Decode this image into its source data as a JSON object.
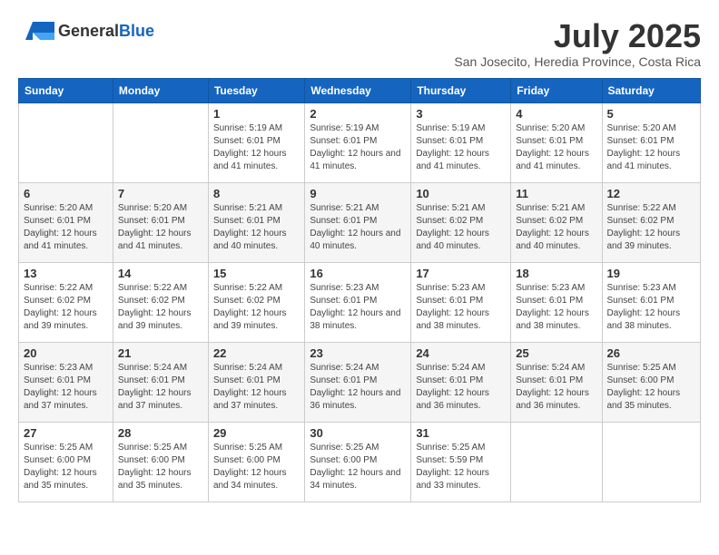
{
  "header": {
    "logo_general": "General",
    "logo_blue": "Blue",
    "month_title": "July 2025",
    "subtitle": "San Josecito, Heredia Province, Costa Rica"
  },
  "days_of_week": [
    "Sunday",
    "Monday",
    "Tuesday",
    "Wednesday",
    "Thursday",
    "Friday",
    "Saturday"
  ],
  "weeks": [
    [
      {
        "day": "",
        "info": ""
      },
      {
        "day": "",
        "info": ""
      },
      {
        "day": "1",
        "info": "Sunrise: 5:19 AM\nSunset: 6:01 PM\nDaylight: 12 hours and 41 minutes."
      },
      {
        "day": "2",
        "info": "Sunrise: 5:19 AM\nSunset: 6:01 PM\nDaylight: 12 hours and 41 minutes."
      },
      {
        "day": "3",
        "info": "Sunrise: 5:19 AM\nSunset: 6:01 PM\nDaylight: 12 hours and 41 minutes."
      },
      {
        "day": "4",
        "info": "Sunrise: 5:20 AM\nSunset: 6:01 PM\nDaylight: 12 hours and 41 minutes."
      },
      {
        "day": "5",
        "info": "Sunrise: 5:20 AM\nSunset: 6:01 PM\nDaylight: 12 hours and 41 minutes."
      }
    ],
    [
      {
        "day": "6",
        "info": "Sunrise: 5:20 AM\nSunset: 6:01 PM\nDaylight: 12 hours and 41 minutes."
      },
      {
        "day": "7",
        "info": "Sunrise: 5:20 AM\nSunset: 6:01 PM\nDaylight: 12 hours and 41 minutes."
      },
      {
        "day": "8",
        "info": "Sunrise: 5:21 AM\nSunset: 6:01 PM\nDaylight: 12 hours and 40 minutes."
      },
      {
        "day": "9",
        "info": "Sunrise: 5:21 AM\nSunset: 6:01 PM\nDaylight: 12 hours and 40 minutes."
      },
      {
        "day": "10",
        "info": "Sunrise: 5:21 AM\nSunset: 6:02 PM\nDaylight: 12 hours and 40 minutes."
      },
      {
        "day": "11",
        "info": "Sunrise: 5:21 AM\nSunset: 6:02 PM\nDaylight: 12 hours and 40 minutes."
      },
      {
        "day": "12",
        "info": "Sunrise: 5:22 AM\nSunset: 6:02 PM\nDaylight: 12 hours and 39 minutes."
      }
    ],
    [
      {
        "day": "13",
        "info": "Sunrise: 5:22 AM\nSunset: 6:02 PM\nDaylight: 12 hours and 39 minutes."
      },
      {
        "day": "14",
        "info": "Sunrise: 5:22 AM\nSunset: 6:02 PM\nDaylight: 12 hours and 39 minutes."
      },
      {
        "day": "15",
        "info": "Sunrise: 5:22 AM\nSunset: 6:02 PM\nDaylight: 12 hours and 39 minutes."
      },
      {
        "day": "16",
        "info": "Sunrise: 5:23 AM\nSunset: 6:01 PM\nDaylight: 12 hours and 38 minutes."
      },
      {
        "day": "17",
        "info": "Sunrise: 5:23 AM\nSunset: 6:01 PM\nDaylight: 12 hours and 38 minutes."
      },
      {
        "day": "18",
        "info": "Sunrise: 5:23 AM\nSunset: 6:01 PM\nDaylight: 12 hours and 38 minutes."
      },
      {
        "day": "19",
        "info": "Sunrise: 5:23 AM\nSunset: 6:01 PM\nDaylight: 12 hours and 38 minutes."
      }
    ],
    [
      {
        "day": "20",
        "info": "Sunrise: 5:23 AM\nSunset: 6:01 PM\nDaylight: 12 hours and 37 minutes."
      },
      {
        "day": "21",
        "info": "Sunrise: 5:24 AM\nSunset: 6:01 PM\nDaylight: 12 hours and 37 minutes."
      },
      {
        "day": "22",
        "info": "Sunrise: 5:24 AM\nSunset: 6:01 PM\nDaylight: 12 hours and 37 minutes."
      },
      {
        "day": "23",
        "info": "Sunrise: 5:24 AM\nSunset: 6:01 PM\nDaylight: 12 hours and 36 minutes."
      },
      {
        "day": "24",
        "info": "Sunrise: 5:24 AM\nSunset: 6:01 PM\nDaylight: 12 hours and 36 minutes."
      },
      {
        "day": "25",
        "info": "Sunrise: 5:24 AM\nSunset: 6:01 PM\nDaylight: 12 hours and 36 minutes."
      },
      {
        "day": "26",
        "info": "Sunrise: 5:25 AM\nSunset: 6:00 PM\nDaylight: 12 hours and 35 minutes."
      }
    ],
    [
      {
        "day": "27",
        "info": "Sunrise: 5:25 AM\nSunset: 6:00 PM\nDaylight: 12 hours and 35 minutes."
      },
      {
        "day": "28",
        "info": "Sunrise: 5:25 AM\nSunset: 6:00 PM\nDaylight: 12 hours and 35 minutes."
      },
      {
        "day": "29",
        "info": "Sunrise: 5:25 AM\nSunset: 6:00 PM\nDaylight: 12 hours and 34 minutes."
      },
      {
        "day": "30",
        "info": "Sunrise: 5:25 AM\nSunset: 6:00 PM\nDaylight: 12 hours and 34 minutes."
      },
      {
        "day": "31",
        "info": "Sunrise: 5:25 AM\nSunset: 5:59 PM\nDaylight: 12 hours and 33 minutes."
      },
      {
        "day": "",
        "info": ""
      },
      {
        "day": "",
        "info": ""
      }
    ]
  ]
}
